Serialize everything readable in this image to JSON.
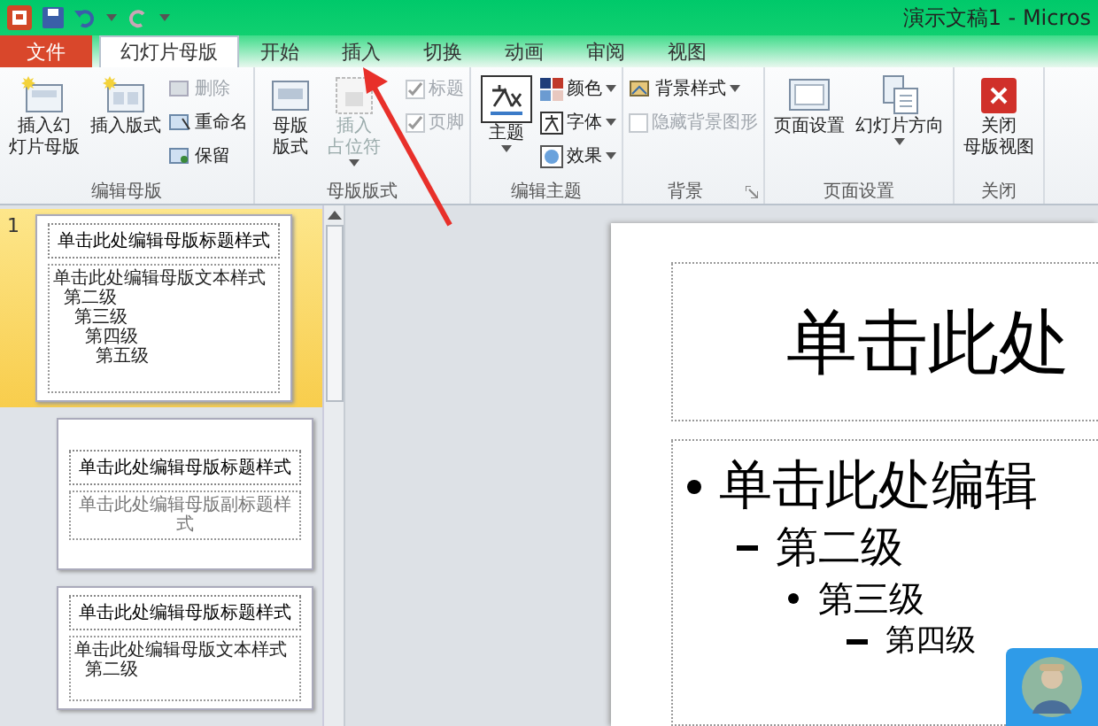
{
  "window": {
    "title": "演示文稿1 - Micros"
  },
  "tabs": [
    {
      "label": "文件",
      "kind": "file",
      "selected": false
    },
    {
      "label": "幻灯片母版",
      "kind": "tab",
      "selected": true
    },
    {
      "label": "开始",
      "kind": "tab",
      "selected": false
    },
    {
      "label": "插入",
      "kind": "tab",
      "selected": false
    },
    {
      "label": "切换",
      "kind": "tab",
      "selected": false
    },
    {
      "label": "动画",
      "kind": "tab",
      "selected": false
    },
    {
      "label": "审阅",
      "kind": "tab",
      "selected": false
    },
    {
      "label": "视图",
      "kind": "tab",
      "selected": false
    }
  ],
  "ribbon": {
    "groups": [
      {
        "label": "编辑母版",
        "controls": [
          {
            "kind": "large",
            "lines": [
              "插入幻",
              "灯片母版"
            ],
            "disabled": false
          },
          {
            "kind": "large",
            "lines": [
              "插入版式"
            ],
            "disabled": false
          },
          {
            "kind": "stack",
            "items": [
              {
                "kind": "small",
                "label": "删除",
                "disabled": true
              },
              {
                "kind": "small",
                "label": "重命名",
                "disabled": false
              },
              {
                "kind": "small",
                "label": "保留",
                "disabled": false
              }
            ]
          }
        ]
      },
      {
        "label": "母版版式",
        "controls": [
          {
            "kind": "large",
            "lines": [
              "母版",
              "版式"
            ],
            "disabled": false
          },
          {
            "kind": "large",
            "lines": [
              "插入",
              "占位符"
            ],
            "dropdown": true,
            "disabled": true
          },
          {
            "kind": "stack",
            "items": [
              {
                "kind": "check",
                "label": "标题",
                "checked": true,
                "disabled": true
              },
              {
                "kind": "check",
                "label": "页脚",
                "checked": true,
                "disabled": true
              }
            ]
          }
        ]
      },
      {
        "label": "编辑主题",
        "controls": [
          {
            "kind": "large",
            "lines": [
              "主题"
            ],
            "dropdown": true,
            "disabled": false
          },
          {
            "kind": "stack",
            "items": [
              {
                "kind": "small",
                "label": "颜色",
                "dropdown": true,
                "disabled": false
              },
              {
                "kind": "small",
                "label": "字体",
                "dropdown": true,
                "disabled": false
              },
              {
                "kind": "small",
                "label": "效果",
                "dropdown": true,
                "disabled": false
              }
            ]
          }
        ]
      },
      {
        "label": "背景",
        "launcher": true,
        "controls": [
          {
            "kind": "stack",
            "items": [
              {
                "kind": "small",
                "label": "背景样式",
                "dropdown": true,
                "disabled": false
              },
              {
                "kind": "check",
                "label": "隐藏背景图形",
                "checked": false,
                "disabled": true
              }
            ]
          }
        ]
      },
      {
        "label": "页面设置",
        "controls": [
          {
            "kind": "large",
            "lines": [
              "页面设置"
            ],
            "disabled": false
          },
          {
            "kind": "large",
            "lines": [
              "幻灯片方向"
            ],
            "dropdown": true,
            "disabled": false
          }
        ]
      },
      {
        "label": "关闭",
        "controls": [
          {
            "kind": "large",
            "lines": [
              "关闭",
              "母版视图"
            ],
            "disabled": false
          }
        ]
      }
    ]
  },
  "slides_pane": {
    "thumbnails": [
      {
        "number": "1",
        "kind": "master",
        "selected": true,
        "title": "单击此处编辑母版标题样式",
        "body": [
          "单击此处编辑母版文本样式",
          "第二级",
          "第三级",
          "第四级",
          "第五级"
        ]
      },
      {
        "kind": "title",
        "selected": false,
        "title": "单击此处编辑母版标题样式",
        "body": [
          "单击此处编辑母版副标题样式"
        ]
      },
      {
        "kind": "content",
        "selected": false,
        "title": "单击此处编辑母版标题样式",
        "body": [
          "单击此处编辑母版文本样式",
          "第二级"
        ]
      }
    ]
  },
  "slide": {
    "title": "单击此处",
    "body": [
      {
        "text": "单击此处编辑",
        "children": [
          {
            "text": "第二级",
            "children": [
              {
                "text": "第三级",
                "children": [
                  {
                    "text": "第四级"
                  }
                ]
              }
            ]
          }
        ]
      }
    ]
  }
}
